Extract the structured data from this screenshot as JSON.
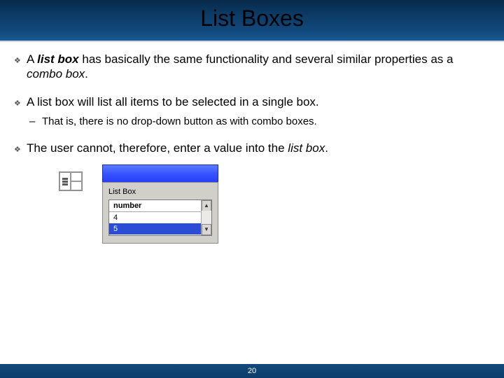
{
  "title": "List Boxes",
  "bullets": {
    "b1_pre": "A ",
    "b1_term": "list box",
    "b1_mid": " has basically the same functionality and several similar properties as a ",
    "b1_term2": "combo box",
    "b1_post": ".",
    "b2": "A list box will list all items to be selected in a single box.",
    "b2_sub": "That is, there is no drop-down button as with combo boxes.",
    "b3_pre": "The user cannot, therefore, enter a value into the ",
    "b3_term": "list box",
    "b3_post": "."
  },
  "figure": {
    "label": "List Box",
    "header": "number",
    "row1": "4",
    "row2": "5"
  },
  "page_number": "20"
}
